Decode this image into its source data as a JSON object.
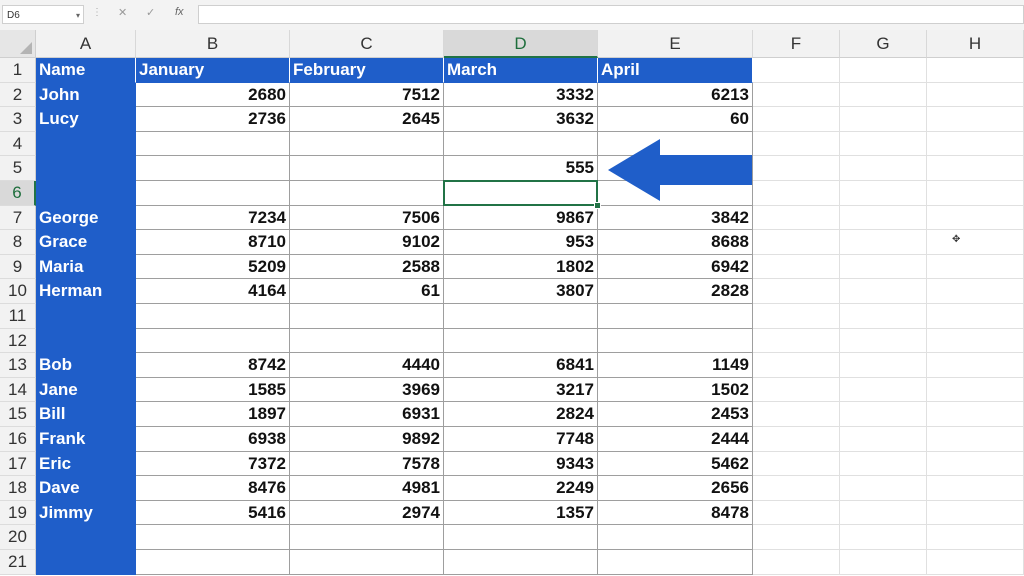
{
  "formula_bar": {
    "name_box": "D6",
    "dots": "⋮",
    "cancel_icon": "✕",
    "enter_icon": "✓",
    "fx_label": "fx",
    "formula": ""
  },
  "columns": [
    "A",
    "B",
    "C",
    "D",
    "E",
    "F",
    "G",
    "H"
  ],
  "active_column": "D",
  "active_row": 6,
  "rows": [
    {
      "n": "1",
      "cells": [
        "Name",
        "January",
        "February",
        "March",
        "April"
      ]
    },
    {
      "n": "2",
      "cells": [
        "John",
        "2680",
        "7512",
        "3332",
        "6213"
      ]
    },
    {
      "n": "3",
      "cells": [
        "Lucy",
        "2736",
        "2645",
        "3632",
        "60"
      ]
    },
    {
      "n": "4",
      "cells": [
        "",
        "",
        "",
        "",
        ""
      ]
    },
    {
      "n": "5",
      "cells": [
        "",
        "",
        "",
        "555",
        ""
      ]
    },
    {
      "n": "6",
      "cells": [
        "",
        "",
        "",
        "",
        ""
      ]
    },
    {
      "n": "7",
      "cells": [
        "George",
        "7234",
        "7506",
        "9867",
        "3842"
      ]
    },
    {
      "n": "8",
      "cells": [
        "Grace",
        "8710",
        "9102",
        "953",
        "8688"
      ]
    },
    {
      "n": "9",
      "cells": [
        "Maria",
        "5209",
        "2588",
        "1802",
        "6942"
      ]
    },
    {
      "n": "10",
      "cells": [
        "Herman",
        "4164",
        "61",
        "3807",
        "2828"
      ]
    },
    {
      "n": "11",
      "cells": [
        "",
        "",
        "",
        "",
        ""
      ]
    },
    {
      "n": "12",
      "cells": [
        "",
        "",
        "",
        "",
        ""
      ]
    },
    {
      "n": "13",
      "cells": [
        "Bob",
        "8742",
        "4440",
        "6841",
        "1149"
      ]
    },
    {
      "n": "14",
      "cells": [
        "Jane",
        "1585",
        "3969",
        "3217",
        "1502"
      ]
    },
    {
      "n": "15",
      "cells": [
        "Bill",
        "1897",
        "6931",
        "2824",
        "2453"
      ]
    },
    {
      "n": "16",
      "cells": [
        "Frank",
        "6938",
        "9892",
        "7748",
        "2444"
      ]
    },
    {
      "n": "17",
      "cells": [
        "Eric",
        "7372",
        "7578",
        "9343",
        "5462"
      ]
    },
    {
      "n": "18",
      "cells": [
        "Dave",
        "8476",
        "4981",
        "2249",
        "2656"
      ]
    },
    {
      "n": "19",
      "cells": [
        "Jimmy",
        "5416",
        "2974",
        "1357",
        "8478"
      ]
    },
    {
      "n": "20",
      "cells": [
        "",
        "",
        "",
        "",
        ""
      ]
    },
    {
      "n": "21",
      "cells": [
        "",
        "",
        "",
        "",
        ""
      ]
    }
  ],
  "colors": {
    "header_fill": "#1f5ec9",
    "arrow": "#1f5ec9",
    "selection": "#217346"
  }
}
